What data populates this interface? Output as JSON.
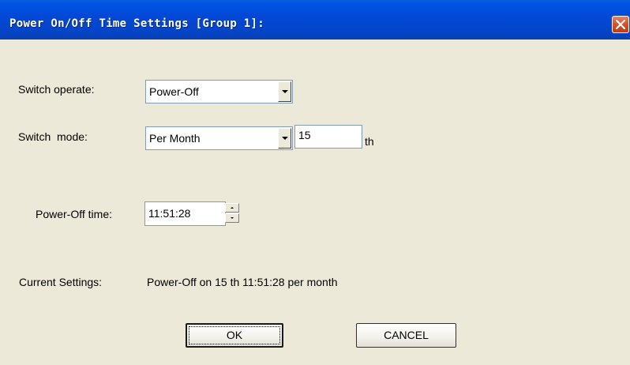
{
  "window": {
    "title": "Power On/Off Time Settings [Group 1]:"
  },
  "form": {
    "switch_operate": {
      "label": "Switch operate:",
      "value": "Power-Off"
    },
    "switch_mode": {
      "label": "Switch  mode:",
      "value": "Per Month",
      "day_value": "15",
      "day_suffix": "th"
    },
    "power_off_time": {
      "label": "Power-Off time:",
      "value": "11:51:28"
    },
    "current_settings": {
      "label": "Current Settings:",
      "value": "Power-Off on 15 th 11:51:28 per month"
    }
  },
  "buttons": {
    "ok_label": "OK",
    "cancel_label": "CANCEL"
  },
  "icons": {
    "close": "close-icon",
    "dropdown": "chevron-down-icon",
    "spin_up": "arrow-up-icon",
    "spin_down": "arrow-down-icon"
  },
  "colors": {
    "titlebar": "#0348d6",
    "dialog_bg": "#ece9d8",
    "close_button": "#d8542c"
  }
}
